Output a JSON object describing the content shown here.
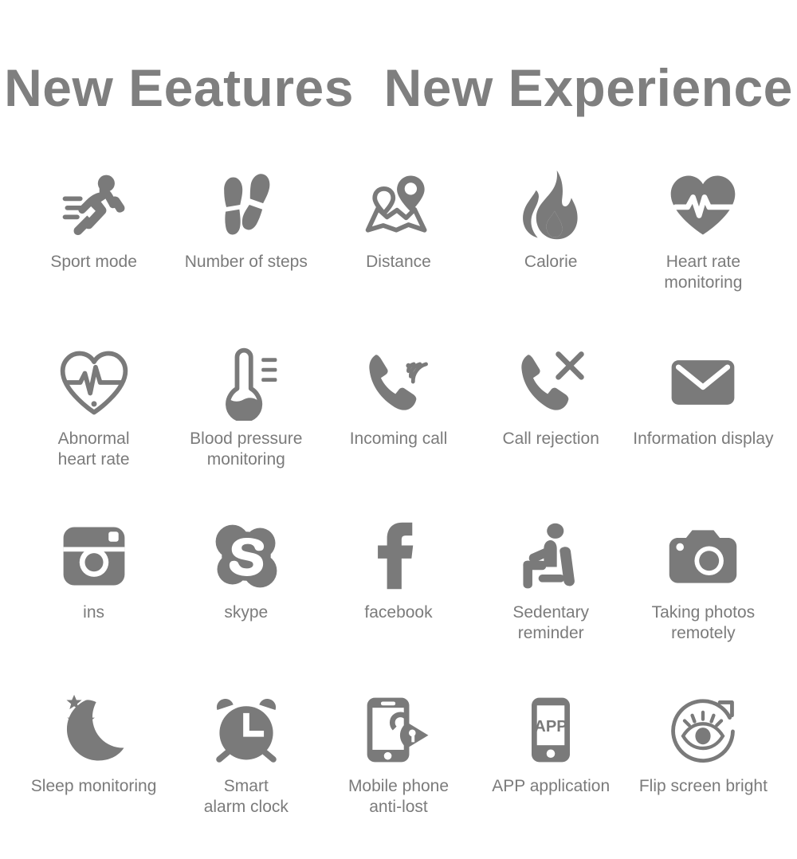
{
  "header": {
    "title": "New Eeatures  New Experience",
    "title_color": "#7f7f7f"
  },
  "theme": {
    "icon_color": "#7a7a7a",
    "label_color": "#7b7b7b",
    "background": "#ffffff"
  },
  "features": [
    {
      "icon": "running-person-icon",
      "label": "Sport mode"
    },
    {
      "icon": "footsteps-icon",
      "label": "Number of steps"
    },
    {
      "icon": "map-pins-icon",
      "label": "Distance"
    },
    {
      "icon": "flame-icon",
      "label": "Calorie"
    },
    {
      "icon": "heart-pulse-icon",
      "label": "Heart rate\nmonitoring"
    },
    {
      "icon": "heart-outline-pulse-icon",
      "label": "Abnormal\nheart rate"
    },
    {
      "icon": "thermometer-icon",
      "label": "Blood pressure\nmonitoring"
    },
    {
      "icon": "phone-ringing-icon",
      "label": "Incoming call"
    },
    {
      "icon": "phone-reject-icon",
      "label": "Call rejection"
    },
    {
      "icon": "envelope-icon",
      "label": "Information display"
    },
    {
      "icon": "instagram-icon",
      "label": "ins"
    },
    {
      "icon": "skype-icon",
      "label": "skype"
    },
    {
      "icon": "facebook-icon",
      "label": "facebook"
    },
    {
      "icon": "sitting-person-icon",
      "label": "Sedentary\nreminder"
    },
    {
      "icon": "camera-icon",
      "label": "Taking photos\nremotely"
    },
    {
      "icon": "moon-stars-icon",
      "label": "Sleep monitoring"
    },
    {
      "icon": "alarm-clock-icon",
      "label": "Smart\nalarm clock"
    },
    {
      "icon": "phone-lock-icon",
      "label": "Mobile phone\nanti-lost"
    },
    {
      "icon": "phone-app-icon",
      "label": "APP application",
      "glyph_text": "APP"
    },
    {
      "icon": "eye-rotate-icon",
      "label": "Flip screen bright"
    }
  ]
}
